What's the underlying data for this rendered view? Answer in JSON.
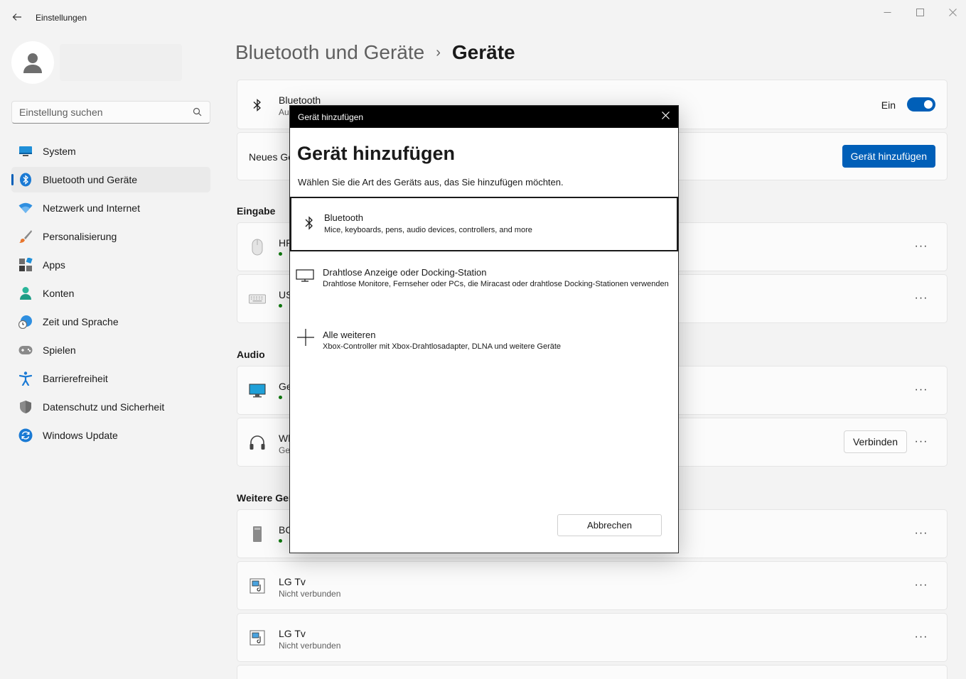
{
  "window": {
    "title": "Einstellungen"
  },
  "search": {
    "placeholder": "Einstellung suchen"
  },
  "sidebar": {
    "items": [
      {
        "label": "System",
        "icon": "monitor-icon"
      },
      {
        "label": "Bluetooth und Geräte",
        "icon": "bluetooth-icon",
        "active": true
      },
      {
        "label": "Netzwerk und Internet",
        "icon": "wifi-icon"
      },
      {
        "label": "Personalisierung",
        "icon": "brush-icon"
      },
      {
        "label": "Apps",
        "icon": "apps-icon"
      },
      {
        "label": "Konten",
        "icon": "account-icon"
      },
      {
        "label": "Zeit und Sprache",
        "icon": "globe-clock-icon"
      },
      {
        "label": "Spielen",
        "icon": "gamepad-icon"
      },
      {
        "label": "Barrierefreiheit",
        "icon": "accessibility-icon"
      },
      {
        "label": "Datenschutz und Sicherheit",
        "icon": "shield-icon"
      },
      {
        "label": "Windows Update",
        "icon": "update-icon"
      }
    ]
  },
  "header": {
    "parent": "Bluetooth und Geräte",
    "separator": "›",
    "current": "Geräte"
  },
  "bluetooth_card": {
    "title": "Bluetooth",
    "subtitle_partial": "Au",
    "toggle_label": "Ein",
    "toggle_on": true
  },
  "add_device_card": {
    "title_partial": "Neues Ge",
    "button": "Gerät hinzufügen"
  },
  "sections": {
    "input": "Eingabe",
    "audio": "Audio",
    "other_partial": "Weitere Ger"
  },
  "devices": {
    "input": [
      {
        "name_partial": "HP",
        "connected": true,
        "icon": "mouse-icon"
      },
      {
        "name_partial": "US",
        "connected": true,
        "icon": "keyboard-icon"
      }
    ],
    "audio": [
      {
        "name_partial": "Ge",
        "connected": true,
        "icon": "display-icon"
      },
      {
        "name_partial": "Wh",
        "sub_partial": "Ge",
        "icon": "headphones-icon",
        "connect_label": "Verbinden"
      }
    ],
    "other": [
      {
        "name_partial": "BC",
        "connected": true,
        "icon": "tower-icon"
      },
      {
        "name": "LG Tv",
        "status": "Nicht verbunden",
        "icon": "media-device-icon"
      },
      {
        "name": "LG Tv",
        "status": "Nicht verbunden",
        "icon": "media-device-icon"
      }
    ]
  },
  "more_label": "···",
  "dialog": {
    "titlebar": "Gerät hinzufügen",
    "heading": "Gerät hinzufügen",
    "description": "Wählen Sie die Art des Geräts aus, das Sie hinzufügen möchten.",
    "options": [
      {
        "title": "Bluetooth",
        "desc": "Mice, keyboards, pens, audio devices, controllers, and more",
        "icon": "bluetooth-icon"
      },
      {
        "title": "Drahtlose Anzeige oder Docking-Station",
        "desc": "Drahtlose Monitore, Fernseher oder PCs, die Miracast oder drahtlose Docking-Stationen verwenden",
        "icon": "monitor-outline-icon"
      },
      {
        "title": "Alle weiteren",
        "desc": "Xbox-Controller mit Xbox-Drahtlosadapter, DLNA und weitere Geräte",
        "icon": "plus-icon"
      }
    ],
    "cancel": "Abbrechen"
  },
  "colors": {
    "accent": "#005fb8",
    "connected": "#0f7b0f"
  }
}
